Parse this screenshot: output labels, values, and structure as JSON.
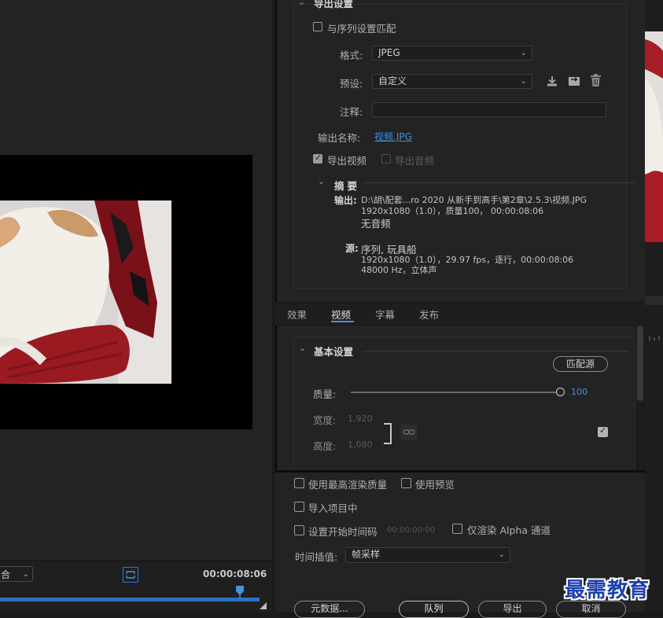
{
  "export_settings": {
    "section_title": "导出设置",
    "match_sequence_label": "与序列设置匹配",
    "format_label": "格式:",
    "format_value": "JPEG",
    "preset_label": "预设:",
    "preset_value": "自定义",
    "comments_label": "注释:",
    "comments_value": "",
    "output_name_label": "输出名称:",
    "output_name_value": "视频.JPG",
    "export_video_label": "导出视频",
    "export_audio_label": "导出音频",
    "summary_title": "摘要",
    "output_label": "输出:",
    "output_path": "D:\\胡\\配套...ro 2020 从新手到高手\\第2章\\2.5.3\\视频.JPG",
    "output_line2_a": "1920x1080（1.0），质量",
    "output_line2_b": "100",
    "output_line2_c": "，  00:00:08:06",
    "output_line3": "无音频",
    "source_label": "源:",
    "source_name": "序列, 玩具船",
    "source_line2": "1920x1080（1.0），29.97 fps，逐行，00:00:08:06",
    "source_line3": "48000 Hz，立体声"
  },
  "tabs": [
    "效果",
    "视频",
    "字幕",
    "发布"
  ],
  "video_settings": {
    "section_title": "基本设置",
    "match_source_button": "匹配源",
    "quality_label": "质量:",
    "quality_value": "100",
    "width_label": "宽度:",
    "width_value": "1,920",
    "height_label": "高度:",
    "height_value": "1,080"
  },
  "options": {
    "max_render_quality": "使用最高渲染质量",
    "use_previews": "使用预览",
    "import_into_project": "导入项目中",
    "set_start_timecode": "设置开始时间码",
    "start_timecode_value": "00:00:00:00",
    "render_alpha_only": "仅渲染 Alpha 通道",
    "time_interpolation_label": "时间插值:",
    "time_interpolation_value": "帧采样"
  },
  "footer": {
    "metadata_button": "元数据...",
    "queue_button": "队列",
    "export_button": "导出",
    "cancel_button": "取消"
  },
  "monitor": {
    "fit_value": "合",
    "timecode": "00:00:08:06"
  },
  "watermark": "最需教育",
  "colors": {
    "accent_blue": "#4a90e2",
    "panel_bg": "#232323",
    "watermark_blue": "#1d3fae"
  }
}
